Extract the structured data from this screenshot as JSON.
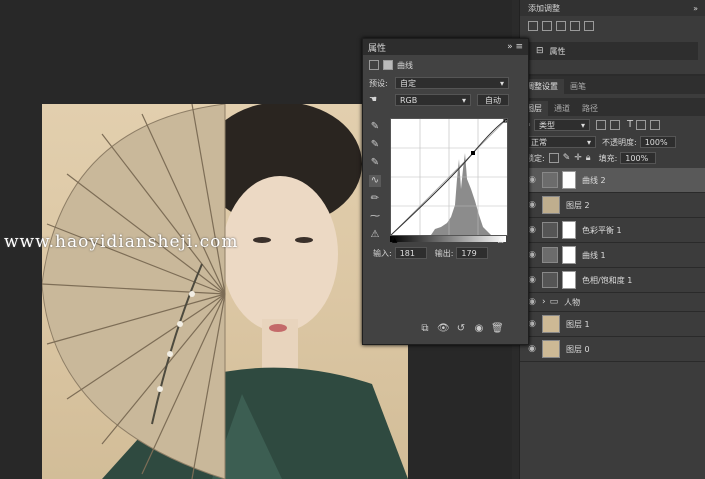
{
  "canvas": {
    "watermark": "www.haoyidiansheji.com"
  },
  "dock_top": {
    "title": "添加调整",
    "properties_label": "属性"
  },
  "properties": {
    "title": "属性",
    "subtitle": "曲线",
    "preset_label": "预设:",
    "preset_value": "自定",
    "channel": "RGB",
    "auto_button": "自动",
    "input_label": "输入:",
    "input_value": "181",
    "output_label": "输出:",
    "output_value": "179"
  },
  "panel_tabs": [
    "调整设置",
    "画笔"
  ],
  "layers_tabs": [
    "图层",
    "通道",
    "路径"
  ],
  "layers": {
    "kind_filter": "类型",
    "blend_mode": "正常",
    "opacity_label": "不透明度:",
    "opacity_value": "100%",
    "lock_label": "锁定:",
    "fill_label": "填充:",
    "fill_value": "100%",
    "items": [
      {
        "name": "曲线 2"
      },
      {
        "name": "图层 2"
      },
      {
        "name": "色彩平衡 1"
      },
      {
        "name": "曲线 1"
      },
      {
        "name": "色相/饱和度 1"
      },
      {
        "name": "人物"
      },
      {
        "name": "图层 1"
      },
      {
        "name": "图层 0"
      }
    ]
  },
  "colors": {
    "accent": "#595959",
    "panel": "#3c3c3c"
  }
}
